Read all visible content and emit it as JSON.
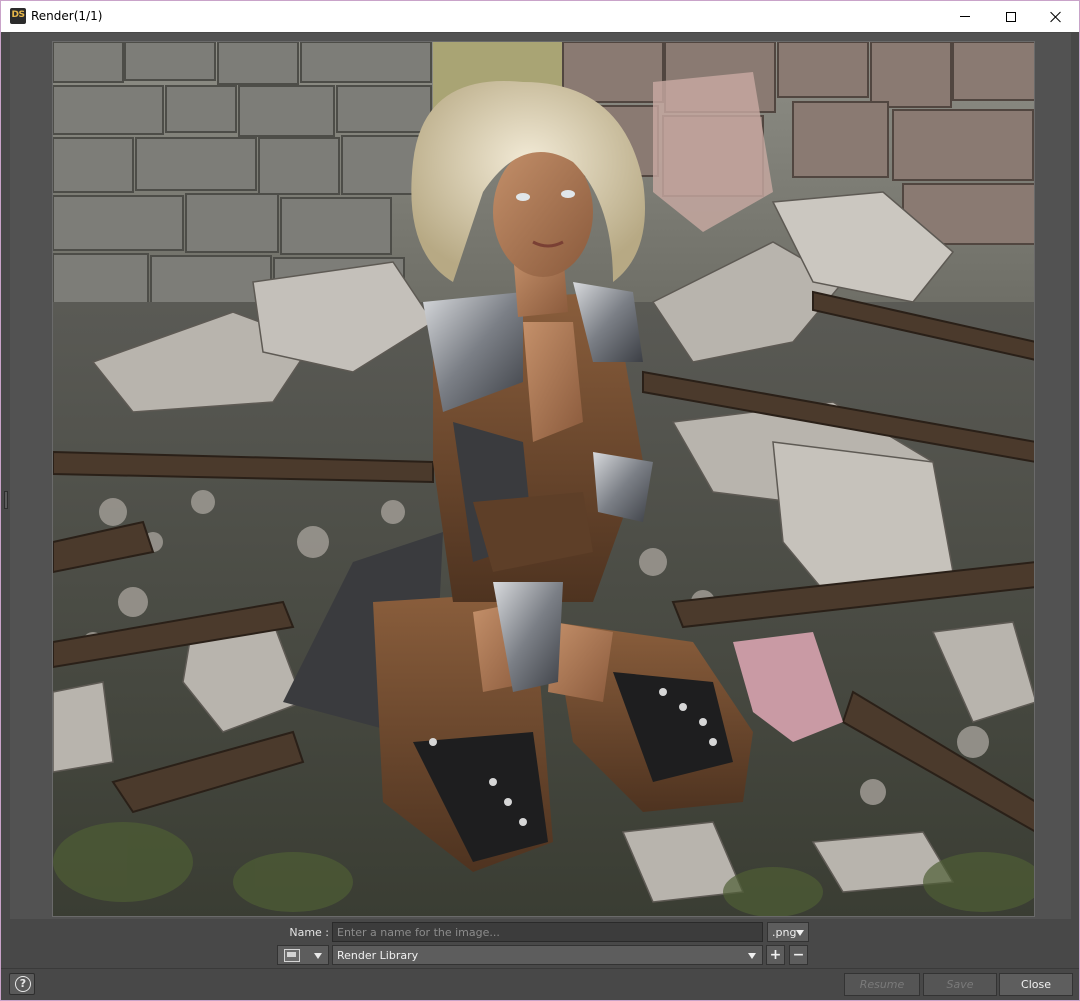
{
  "window": {
    "title": "Render(1/1)",
    "app_icon_text": "DS"
  },
  "render_image": {
    "description_icon": "rendered-image"
  },
  "controls": {
    "name_label": "Name :",
    "name_placeholder": "Enter a name for the image...",
    "name_value": "",
    "format_value": ".png",
    "library_value": "Render Library",
    "add_label": "+",
    "remove_label": "−"
  },
  "footer": {
    "help_label": "?",
    "resume_label": "Resume",
    "save_label": "Save",
    "close_label": "Close"
  },
  "colors": {
    "frame_border": "#c9a3c9",
    "panel_bg": "#484848",
    "control_bg": "#5d5d5d"
  }
}
